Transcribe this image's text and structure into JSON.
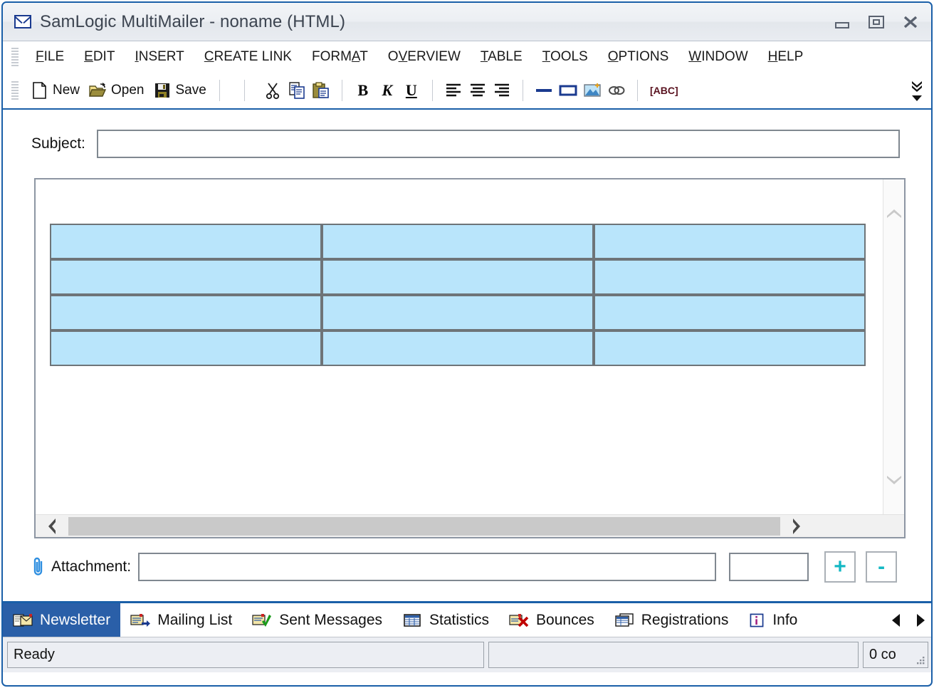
{
  "window": {
    "title": "SamLogic MultiMailer - noname  (HTML)",
    "icon": "envelope-icon",
    "controls": [
      {
        "name": "minimize-button",
        "glyph": "minimize"
      },
      {
        "name": "restore-button",
        "glyph": "restore"
      },
      {
        "name": "close-button",
        "glyph": "close"
      }
    ]
  },
  "menu": {
    "items": [
      {
        "label": "FILE",
        "accel_index": 0
      },
      {
        "label": "EDIT",
        "accel_index": 0
      },
      {
        "label": "INSERT",
        "accel_index": 0
      },
      {
        "label": "CREATE LINK",
        "accel_index": 0
      },
      {
        "label": "FORMAT",
        "accel_index": 4
      },
      {
        "label": "OVERVIEW",
        "accel_index": 1
      },
      {
        "label": "TABLE",
        "accel_index": 0
      },
      {
        "label": "TOOLS",
        "accel_index": 0
      },
      {
        "label": "OPTIONS",
        "accel_index": 0
      },
      {
        "label": "WINDOW",
        "accel_index": 0
      },
      {
        "label": "HELP",
        "accel_index": 0
      }
    ]
  },
  "toolbar": {
    "new_label": "New",
    "open_label": "Open",
    "save_label": "Save",
    "bold_label": "B",
    "italic_label": "K",
    "underline_label": "U",
    "spellcheck_label": "[ABC]",
    "overflow_label": "More buttons",
    "icons": [
      "new-document-icon",
      "open-folder-icon",
      "save-disk-icon",
      "cut-scissors-icon",
      "copy-icon",
      "paste-icon",
      "bold-icon",
      "italic-icon",
      "underline-icon",
      "align-left-icon",
      "align-center-icon",
      "align-right-icon",
      "horizontal-line-icon",
      "box-icon",
      "insert-image-icon",
      "insert-link-icon",
      "spellcheck-icon"
    ]
  },
  "editor": {
    "subject_label": "Subject:",
    "subject_value": "",
    "subject_placeholder": "",
    "table": {
      "rows": 4,
      "columns": 3,
      "cell_color": "#b9e5fb",
      "border_color": "#6e7478",
      "cells": [
        [
          "",
          "",
          ""
        ],
        [
          "",
          "",
          ""
        ],
        [
          "",
          "",
          ""
        ],
        [
          "",
          "",
          ""
        ]
      ]
    },
    "scroll": {
      "vertical_up": "chevron-up-icon",
      "vertical_down": "chevron-down-icon",
      "horizontal_left": "chevron-left-icon",
      "horizontal_right": "chevron-right-icon"
    }
  },
  "attachment": {
    "icon": "paperclip-icon",
    "label": "Attachment:",
    "path_value": "",
    "path_placeholder": "",
    "size_value": "",
    "size_placeholder": "",
    "add_label": "+",
    "remove_label": "-",
    "accent_color": "#14b8c4"
  },
  "tabs": {
    "active_index": 0,
    "items": [
      {
        "label": "Newsletter",
        "icon": "newsletter-icon"
      },
      {
        "label": "Mailing List",
        "icon": "mailing-list-icon"
      },
      {
        "label": "Sent Messages",
        "icon": "sent-messages-icon"
      },
      {
        "label": "Statistics",
        "icon": "statistics-icon"
      },
      {
        "label": "Bounces",
        "icon": "bounces-icon"
      },
      {
        "label": "Registrations",
        "icon": "registrations-icon"
      },
      {
        "label": "Info",
        "icon": "info-icon"
      }
    ],
    "scroll_left": "triangle-left-icon",
    "scroll_right": "triangle-right-icon"
  },
  "status": {
    "message": "Ready",
    "middle": "",
    "count": "0 co"
  },
  "colors": {
    "window_border": "#1a5fa8",
    "tab_active_bg": "#2a5fa8",
    "table_cell": "#b9e5fb",
    "accent_teal": "#14b8c4"
  }
}
